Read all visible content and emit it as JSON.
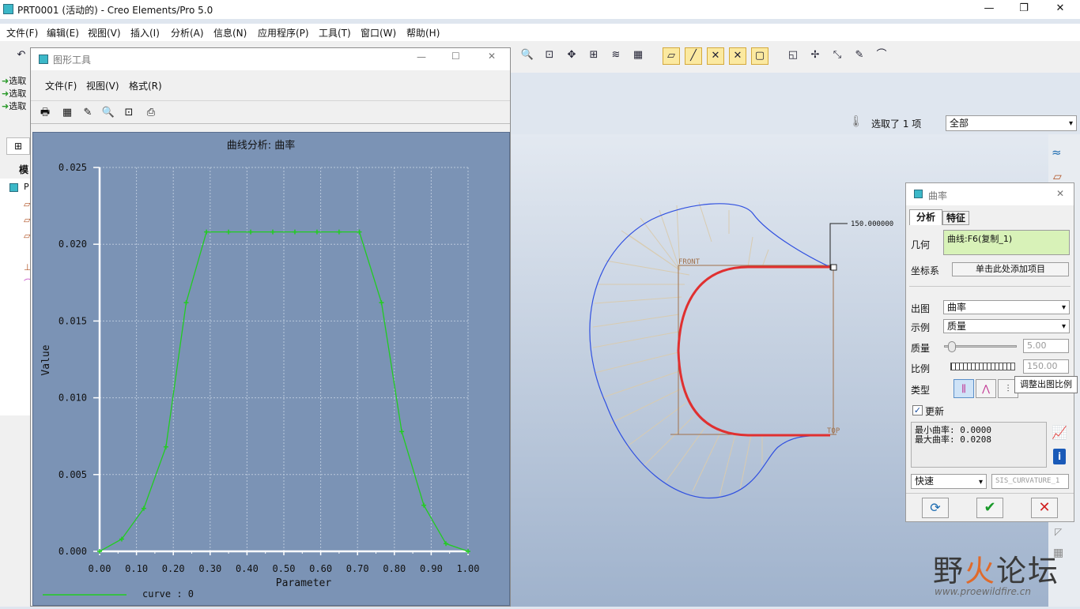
{
  "window": {
    "title": "PRT0001 (活动的) - Creo Elements/Pro 5.0",
    "controls": [
      "—",
      "❐",
      "✕"
    ]
  },
  "menubar": [
    "文件(F)",
    "编辑(E)",
    "视图(V)",
    "插入(I)",
    "分析(A)",
    "信息(N)",
    "应用程序(P)",
    "工具(T)",
    "窗口(W)",
    "帮助(H)"
  ],
  "left_strip": {
    "select_items": [
      "选取",
      "选取",
      "选取"
    ],
    "tab_label": "模",
    "tree_root": "P"
  },
  "selection_bar": {
    "status": "选取了 1 项",
    "filter": "全部"
  },
  "graph_tool": {
    "title": "图形工具",
    "menu": [
      "文件(F)",
      "视图(V)",
      "格式(R)"
    ],
    "tool_icons": [
      "print-icon",
      "grid-icon",
      "edit-icon",
      "zoom-in-icon",
      "zoom-fit-icon",
      "export-icon"
    ],
    "legend": "curve : 0"
  },
  "chart_data": {
    "type": "line",
    "title": "曲线分析:  曲率",
    "xlabel": "Parameter",
    "ylabel": "Value",
    "xlim": [
      0,
      1
    ],
    "ylim": [
      0,
      0.025
    ],
    "xticks": [
      "0.00",
      "0.10",
      "0.20",
      "0.30",
      "0.40",
      "0.50",
      "0.60",
      "0.70",
      "0.80",
      "0.90",
      "1.00"
    ],
    "yticks": [
      "0.000",
      "0.005",
      "0.010",
      "0.015",
      "0.020",
      "0.025"
    ],
    "grid": true,
    "series": [
      {
        "name": "curve : 0",
        "color": "#22cc22",
        "x": [
          0.0,
          0.06,
          0.12,
          0.18,
          0.235,
          0.29,
          0.35,
          0.41,
          0.47,
          0.53,
          0.59,
          0.65,
          0.705,
          0.765,
          0.82,
          0.88,
          0.94,
          1.0
        ],
        "y": [
          0.0,
          0.0008,
          0.0028,
          0.0068,
          0.0162,
          0.0208,
          0.0208,
          0.0208,
          0.0208,
          0.0208,
          0.0208,
          0.0208,
          0.0208,
          0.0162,
          0.0078,
          0.003,
          0.0005,
          0.0
        ]
      }
    ]
  },
  "viewport": {
    "value_label": "150.000000",
    "plane_front": "FRONT",
    "plane_top": "TOP",
    "curve_color": "#e03030",
    "porcupine_color": "#3050e0"
  },
  "curvature_dialog": {
    "title": "曲率",
    "tabs": [
      "分析",
      "特征"
    ],
    "geometry_label": "几何",
    "geometry_value": "曲线:F6(复制_1)",
    "csys_label": "坐标系",
    "csys_button": "单击此处添加项目",
    "plot_label": "出图",
    "plot_value": "曲率",
    "example_label": "示例",
    "example_value": "质量",
    "quality_label": "质量",
    "quality_value": "5.00",
    "quality_level": 0.05,
    "scale_label": "比例",
    "scale_value": "150.00",
    "type_label": "类型",
    "update_label": "更新",
    "update_checked": true,
    "result_min": "最小曲率: 0.0000",
    "result_max": "最大曲率: 0.0208",
    "mode_value": "快速",
    "name_value": "SIS_CURVATURE_1",
    "tooltip": "调整出图比例"
  },
  "watermark": {
    "title_a": "野",
    "title_b": "火",
    "title_c": "论坛",
    "url": "www.proewildfire.cn"
  }
}
